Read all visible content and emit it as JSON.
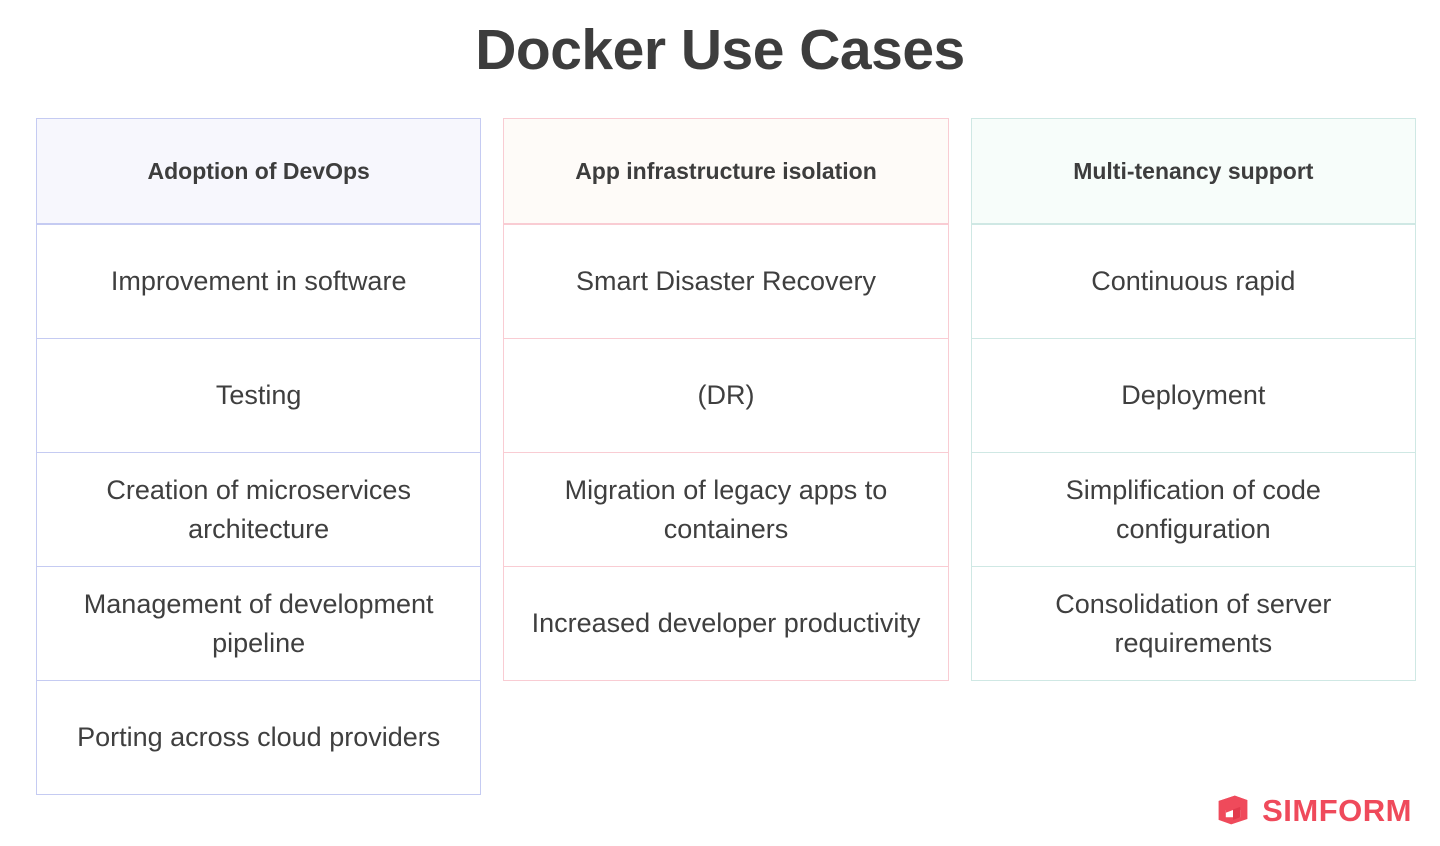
{
  "title": "Docker Use Cases",
  "columns": [
    {
      "header": "Adoption of DevOps",
      "theme": "lavender",
      "border_color": "#c5cbf2",
      "header_bg": "#f7f7fd",
      "rows": [
        "Improvement in software",
        "Testing",
        "Creation of microservices architecture",
        "Management of development pipeline",
        "Porting across cloud providers"
      ]
    },
    {
      "header": "App infrastructure isolation",
      "theme": "rose",
      "border_color": "#f9ccd3",
      "header_bg": "#fefbf8",
      "rows": [
        "Smart Disaster Recovery",
        "(DR)",
        "Migration of legacy apps to containers",
        "Increased developer productivity"
      ]
    },
    {
      "header": "Multi-tenancy support",
      "theme": "mint",
      "border_color": "#cfe8e4",
      "header_bg": "#f7fdfa",
      "rows": [
        "Continuous rapid",
        "Deployment",
        "Simplification of code configuration",
        "Consolidation of server requirements"
      ]
    }
  ],
  "logo": {
    "mark": "simform-logo-mark",
    "text": "SIMFORM",
    "color": "#ef4a5b"
  }
}
